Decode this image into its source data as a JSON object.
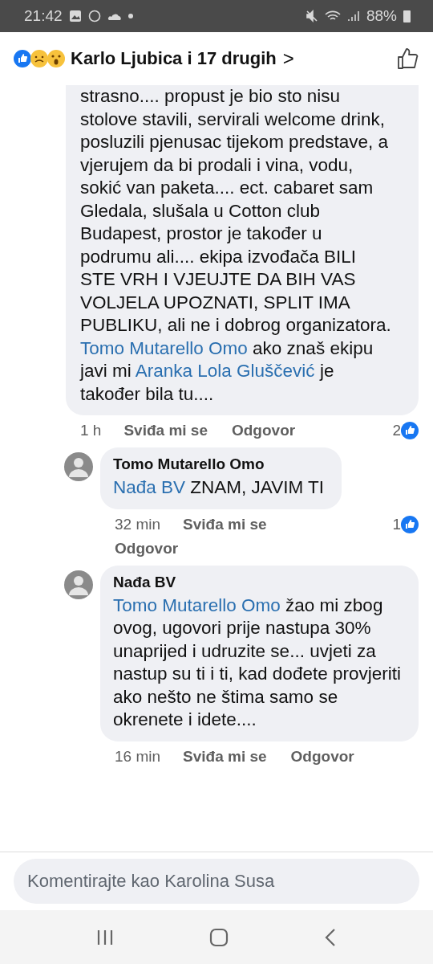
{
  "status_bar": {
    "time": "21:42",
    "battery": "88%"
  },
  "header": {
    "reactors": "Karlo Ljubica i 17 drugih",
    "chevron": ">"
  },
  "comments": [
    {
      "kind": "root",
      "body": [
        {
          "kind": "text",
          "text": "strasno.... propust je bio sto nisu stolove stavili, servirali welcome drink, posluzili pjenusac tijekom predstave, a vjerujem da bi prodali i vina, vodu, sokić van paketa.... ect. cabaret sam Gledala, slušala u Cotton club Budapest, prostor je također u podrumu ali.... ekipa izvođača BILI STE VRH I VJEUJTE DA BIH VAS VOLJELA UPOZNATI, SPLIT IMA PUBLIKU, ali ne i dobrog organizatora. "
        },
        {
          "kind": "mention",
          "text": "Tomo Mutarello Omo"
        },
        {
          "kind": "text",
          "text": " ako znaš ekipu javi mi "
        },
        {
          "kind": "mention",
          "text": "Aranka Lola Gluščević"
        },
        {
          "kind": "text",
          "text": " je također bila tu...."
        }
      ],
      "time": "1 h",
      "like": "Sviđa mi se",
      "reply": "Odgovor",
      "likes": "2"
    },
    {
      "kind": "reply-wrapped",
      "author": "Tomo Mutarello Omo",
      "body": [
        {
          "kind": "mention",
          "text": "Nađa BV"
        },
        {
          "kind": "text",
          "text": " ZNAM, JAVIM TI"
        }
      ],
      "time": "32 min",
      "like": "Sviđa mi se",
      "reply": "Odgovor",
      "likes": "1"
    },
    {
      "kind": "reply",
      "author": "Nađa BV",
      "body": [
        {
          "kind": "mention",
          "text": "Tomo Mutarello Omo"
        },
        {
          "kind": "text",
          "text": " žao mi zbog ovog, ugovori prije nastupa 30% unaprijed i udruzite se... uvjeti za nastup su ti i ti, kad dođete provjeriti ako nešto ne štima samo se okrenete i idete...."
        }
      ],
      "time": "16 min",
      "like": "Sviđa mi se",
      "reply": "Odgovor"
    }
  ],
  "composer": {
    "placeholder": "Komentirajte kao Karolina Susa"
  }
}
